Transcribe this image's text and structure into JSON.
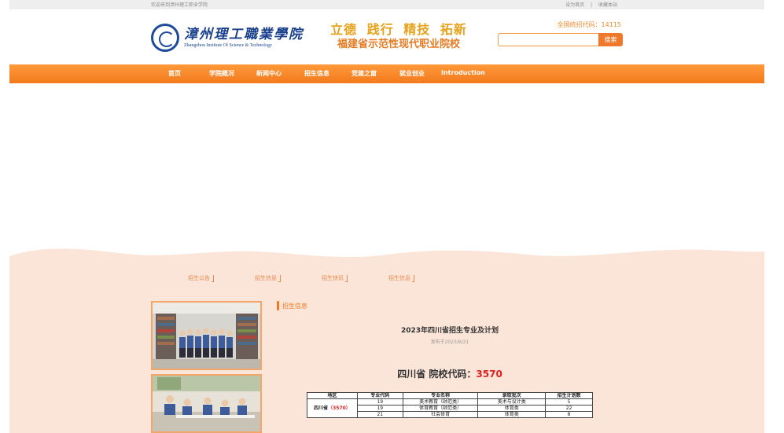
{
  "topbar": {
    "welcome": "欢迎来到漳州理工职业学院",
    "set_home": "设为首页",
    "separator": "|",
    "bookmark": "收藏本站"
  },
  "header": {
    "school_name_cn": "漳州理工職業學院",
    "school_name_en": "Zhangzhou Institute Of Science & Technology",
    "slogan_line1": "立德 践行 精技 拓新",
    "slogan_line2": "福建省示范性现代职业院校",
    "enroll_code_text": "全国统招代码：14115",
    "search_placeholder": "",
    "search_button": "搜索"
  },
  "nav": {
    "items": [
      "首页",
      "学院概况",
      "新闻中心",
      "招生信息",
      "党建之窗",
      "就业创业",
      "Introduction"
    ]
  },
  "subnav": {
    "items": [
      "招生公告",
      "招生信息",
      "招生快讯",
      "招生信息"
    ]
  },
  "article": {
    "section_title": "招生信息",
    "title": "2023年四川省招生专业及计划",
    "date": "发布于2023/6/21",
    "province_label": "四川省  院校代码：",
    "province_code": "3570",
    "table": {
      "headers": [
        "地区",
        "专业代码",
        "专业名称",
        "录取批次",
        "招生计划数"
      ],
      "region_name": "四川省",
      "region_code": "（3570）",
      "rows": [
        [
          "19",
          "美术教育（師范类）",
          "美术与设计类",
          "5"
        ],
        [
          "19",
          "体育教育（師范类）",
          "体育类",
          "22"
        ],
        [
          "21",
          "社会体育",
          "体育类",
          "8"
        ]
      ]
    }
  },
  "colors": {
    "accent_orange": "#f27a1c",
    "slogan_gold": "#e6a21a",
    "logo_blue": "#173f8c",
    "band_peach": "#fbe4d8",
    "code_red": "#e02020"
  }
}
